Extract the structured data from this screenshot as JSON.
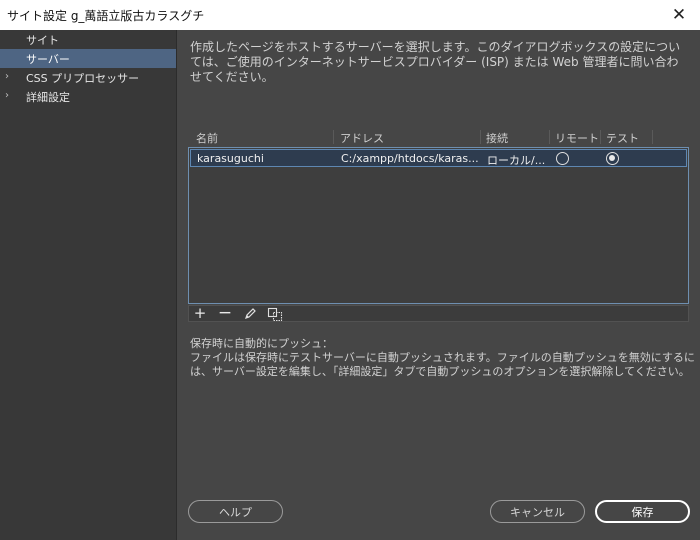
{
  "window": {
    "title": "サイト設定 g_萬語立版古カラスグチ",
    "close_glyph": "✕"
  },
  "sidebar": {
    "items": [
      {
        "label": "サイト",
        "selected": false,
        "expandable": false
      },
      {
        "label": "サーバー",
        "selected": true,
        "expandable": false
      },
      {
        "label": "CSS プリプロセッサー",
        "selected": false,
        "expandable": true
      },
      {
        "label": "詳細設定",
        "selected": false,
        "expandable": true
      }
    ]
  },
  "main": {
    "description": "作成したページをホストするサーバーを選択します。このダイアログボックスの設定については、ご使用のインターネットサービスプロバイダー (ISP) または Web 管理者に問い合わせてください。",
    "table": {
      "headers": [
        "名前",
        "アドレス",
        "接続",
        "リモート",
        "テスト"
      ],
      "rows": [
        {
          "name": "karasuguchi",
          "address": "C:/xampp/htdocs/karas...",
          "connection": "ローカル/...",
          "remote": false,
          "test": true
        }
      ]
    },
    "toolbar": {
      "add": "+",
      "remove": "−",
      "edit_icon": "pencil-icon",
      "duplicate_icon": "duplicate-icon"
    },
    "autopush_label": "保存時に自動的にプッシュ：",
    "autopush_description": "ファイルは保存時にテストサーバーに自動プッシュされます。ファイルの自動プッシュを無効にするには、サーバー設定を編集し、「詳細設定」タブで自動プッシュのオプションを選択解除してください。"
  },
  "buttons": {
    "help": "ヘルプ",
    "cancel": "キャンセル",
    "save": "保存"
  },
  "colors": {
    "background": "#464646",
    "sidebar": "#383838",
    "sidebar_selected": "#4e6583",
    "table_border": "#6e8fb0",
    "row_selected": "#2e3c4f"
  }
}
